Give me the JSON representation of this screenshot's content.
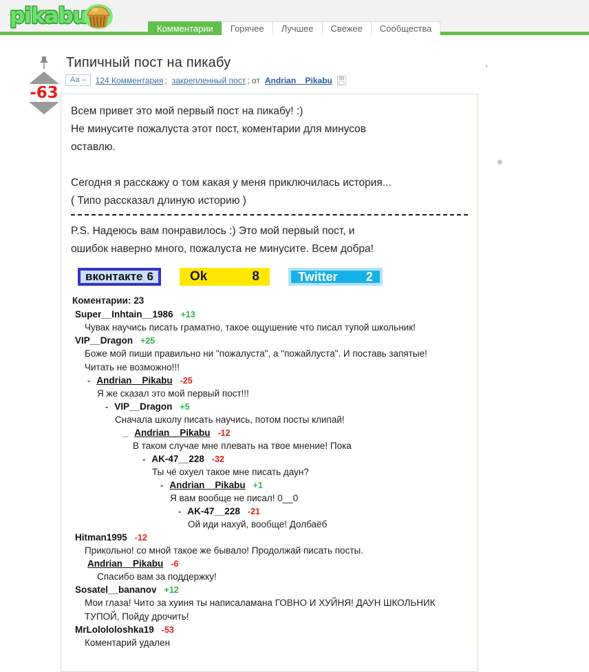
{
  "site": {
    "logo_text": "pikabu",
    "logo_icon": "cupcake-icon"
  },
  "nav": {
    "tabs": [
      {
        "label": "Комментарии",
        "active": true
      },
      {
        "label": "Горячее",
        "active": false
      },
      {
        "label": "Лучшее",
        "active": false
      },
      {
        "label": "Свежее",
        "active": false
      },
      {
        "label": "Сообщества",
        "active": false
      }
    ]
  },
  "post": {
    "title": "Типичный пост на пикабу",
    "score": "-63",
    "pin_icon": "pushpin-icon",
    "upvote_icon": "arrow-up-icon",
    "downvote_icon": "arrow-down-icon",
    "meta": {
      "font_button": "Aa –",
      "comments_link": "124 Комментария",
      "separator1": ";",
      "pinned_link": "закрепленный пост",
      "separator2": "; от",
      "author": "Andrian__Pikabu",
      "save_icon": "save-icon"
    },
    "body": {
      "line1": "Всем привет это мой первый пост на пикабу! :)",
      "line2": "Не минусите пожалуста этот пост, коментарии для минусов",
      "line3": "оставлю.",
      "line4": "Сегодня я расскажу о том какая у меня приключилась история...",
      "line5": " ( Типо рассказал длиную историю )",
      "line6": "P.S. Надеюсь вам понравилось :)   Это мой первый пост, и",
      "line7": "ошибок наверно много, пожалуста не минусите. Всем добра!"
    }
  },
  "share": {
    "vk": {
      "label": "вконтакте",
      "count": "6"
    },
    "ok": {
      "label": "Ok",
      "count": "8"
    },
    "twitter": {
      "label": "Twitter",
      "count": "2"
    }
  },
  "comments": {
    "header_label": "Коментарии:",
    "header_count": "23",
    "items": [
      {
        "indent": 0,
        "dash": "",
        "user": "Super__Inhtain__1986",
        "link": false,
        "score": "+13",
        "sign": "pos",
        "text": "Чувак научись писать граматно, такое ощушение что писал тупой школьник!"
      },
      {
        "indent": 0,
        "dash": "",
        "user": "VIP__Dragon",
        "link": false,
        "score": "+25",
        "sign": "pos",
        "text": "Боже мой пиши правильно ни \"пожалуста\", а \"пожайлуста\". И поставь запятые!\nЧитать не возможно!!!"
      },
      {
        "indent": 1,
        "dash": "-",
        "user": "Andrian__Pikabu",
        "link": true,
        "score": "-25",
        "sign": "neg",
        "text": "Я же сказал это мой первый пост!!!"
      },
      {
        "indent": 2,
        "dash": "-",
        "user": "VIP__Dragon",
        "link": false,
        "score": "+5",
        "sign": "pos",
        "text": "Сначала школу писать научись, потом посты клипай!"
      },
      {
        "indent": 3,
        "dash": "_",
        "user": "Andrian__Pikabu",
        "link": true,
        "score": "-12",
        "sign": "neg",
        "text": "В таком случае мне плевать на твое мнение! Пока"
      },
      {
        "indent": 4,
        "dash": "-",
        "user": "AK-47__228",
        "link": false,
        "score": "-32",
        "sign": "neg",
        "text": "Ты чё охуел такое мне писать даун?"
      },
      {
        "indent": 5,
        "dash": "-",
        "user": "Andrian__Pikabu",
        "link": true,
        "score": "+1",
        "sign": "pos",
        "text": "Я вам вообще не писал! 0__0"
      },
      {
        "indent": 6,
        "dash": "-",
        "user": "AK-47__228",
        "link": false,
        "score": "-21",
        "sign": "neg",
        "text": "Ой иди нахуй, вообще! Долбаёб"
      },
      {
        "indent": 0,
        "dash": "",
        "user": "Hitman1995",
        "link": false,
        "score": "-12",
        "sign": "neg",
        "text": "Прикольно! со мной такое же бывало! Продолжай писать посты."
      },
      {
        "indent": 1,
        "dash": "",
        "user": "Andrian__Pikabu",
        "link": true,
        "score": "-6",
        "sign": "neg",
        "text": "Спасибо вам за поддержку!"
      },
      {
        "indent": 0,
        "dash": "",
        "user": "Sosatel__bananov",
        "link": false,
        "score": "+12",
        "sign": "pos",
        "text": "Мои глаза! Чито за хуиня ты написаламана ГОВНО И ХУЙНЯ! ДАУН ШКОЛЬНИК\nТУПОЙ, Пойду дрочить!"
      },
      {
        "indent": 0,
        "dash": "",
        "user": "MrLolololoshka19",
        "link": false,
        "score": "-53",
        "sign": "neg",
        "text": "Коментарий удален"
      }
    ]
  },
  "colors": {
    "brand_green": "#63bf4b",
    "negative_red": "#e81b1b",
    "positive_green": "#2fb34a",
    "vk_blue": "#3632c8",
    "ok_yellow": "#ffe800",
    "twitter_blue": "#16b0e8"
  }
}
